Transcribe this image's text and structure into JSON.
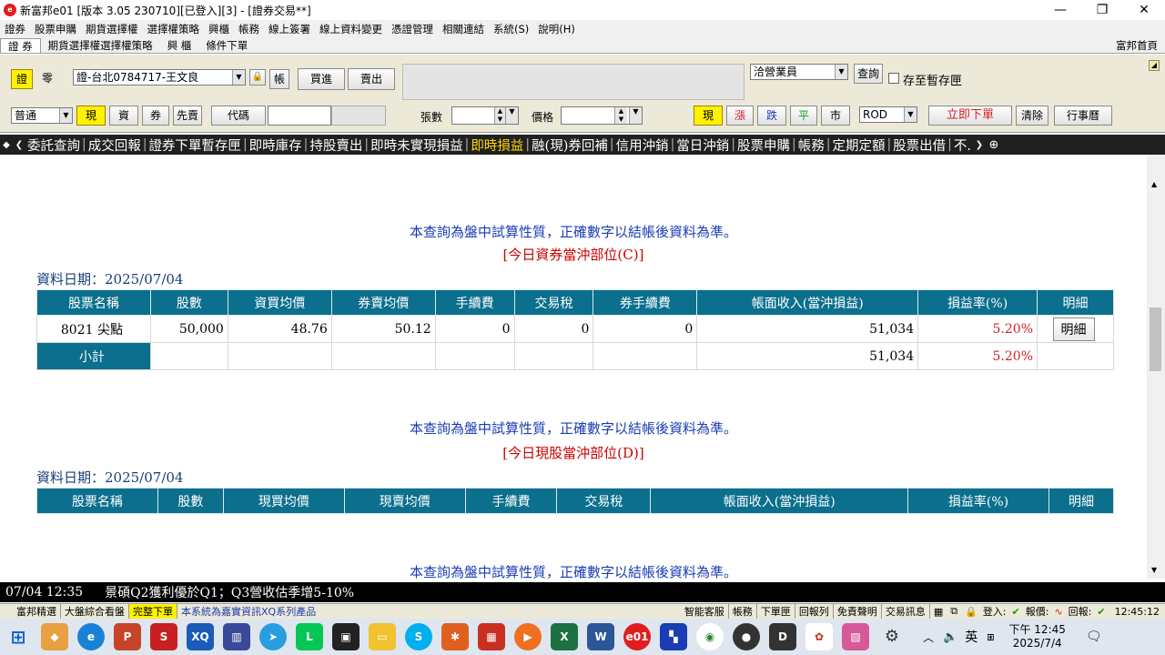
{
  "window": {
    "title": "新富邦e01 [版本 3.05 230710][已登入][3] - [證券交易**]"
  },
  "menu": [
    "證券",
    "股票申購",
    "期貨選擇權",
    "選擇權策略",
    "興櫃",
    "帳務",
    "線上簽署",
    "線上資料變更",
    "憑證管理",
    "相關連結",
    "系統(S)",
    "說明(H)"
  ],
  "topTabs": [
    "證 券",
    "期貨選擇權選擇權策略",
    "興 櫃",
    "條件下單"
  ],
  "topTabsRight": "富邦首頁",
  "toolbar": {
    "stock_btn": "證",
    "odd_btn": "零",
    "account": "證-台北0784717-王文良",
    "account_btn": "帳",
    "buy_btn": "買進",
    "sell_btn": "賣出",
    "broker": "洽營業員",
    "query_btn": "查詢",
    "save_temp": "存至暫存匣",
    "order_type": "普通",
    "cash_btn": "現",
    "margin_btn": "資",
    "short_btn": "券",
    "first_sell_btn": "先賣",
    "code_btn": "代碼",
    "qty_label": "張數",
    "price_label": "價格",
    "price_cash_btn": "現",
    "up_btn": "漲",
    "down_btn": "跌",
    "flat_btn": "平",
    "market_btn": "市",
    "tif": "ROD",
    "place_order_btn": "立即下單",
    "clear_btn": "清除",
    "calendar_btn": "行事曆"
  },
  "funcTabs": [
    "委託查詢",
    "成交回報",
    "證券下單暫存匣",
    "即時庫存",
    "持股賣出",
    "即時未實現損益",
    "即時損益",
    "融(現)券回補",
    "信用沖銷",
    "當日沖銷",
    "股票申購",
    "帳務",
    "定期定額",
    "股票出借",
    "不."
  ],
  "funcTabActive": "即時損益",
  "notice1": "本查詢為盤中試算性質，正確數字以結帳後資料為準。",
  "section1": "[今日資券當沖部位(C)]",
  "date1": "資料日期：2025/07/04",
  "table1": {
    "headers": [
      "股票名稱",
      "股數",
      "資買均價",
      "券賣均價",
      "手續費",
      "交易稅",
      "券手續費",
      "帳面收入(當沖損益)",
      "損益率(%)",
      "明細"
    ],
    "row": [
      "8021 尖點",
      "50,000",
      "48.76",
      "50.12",
      "0",
      "0",
      "0",
      "51,034",
      "5.20%",
      "明細"
    ],
    "subtotal": [
      "小計",
      "51,034",
      "5.20%"
    ]
  },
  "notice2": "本查詢為盤中試算性質，正確數字以結帳後資料為準。",
  "section2": "[今日現股當沖部位(D)]",
  "date2": "資料日期：2025/07/04",
  "table2": {
    "headers": [
      "股票名稱",
      "股數",
      "現買均價",
      "現賣均價",
      "手續費",
      "交易稅",
      "帳面收入(當沖損益)",
      "損益率(%)",
      "明細"
    ]
  },
  "notice3": "本查詢為盤中試算性質，正確數字以結帳後資料為準。",
  "ticker": {
    "time": "07/04 12:35",
    "text": "景碩Q2獲利優於Q1；Q3營收估季增5-10%"
  },
  "status": {
    "tabs": [
      "富邦精選",
      "大盤綜合看盤",
      "完整下單"
    ],
    "product": "本系統為嘉實資訊XQ系列產品",
    "right": [
      "智能客服",
      "帳務",
      "下單匣",
      "回報列",
      "免責聲明",
      "交易訊息"
    ],
    "login": "登入:",
    "quote": "報價:",
    "report": "回報:",
    "clock": "12:45:12"
  },
  "taskbar": {
    "ime": "英",
    "time": "下午 12:45",
    "date": "2025/7/4"
  }
}
